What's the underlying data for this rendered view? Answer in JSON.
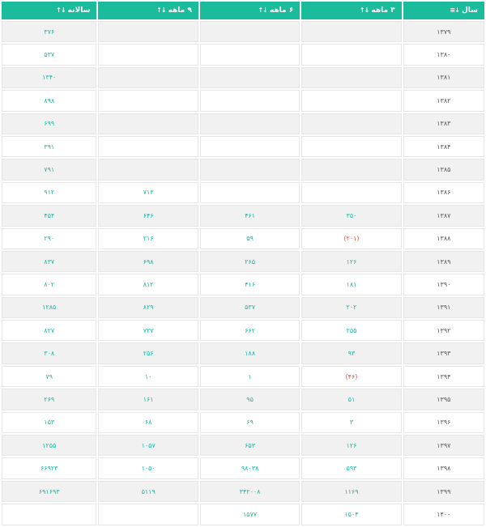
{
  "header": {
    "year": "سال",
    "m3": "۳ ماهه",
    "m6": "۶ ماهه",
    "m9": "۹ ماهه",
    "annual": "سالانه",
    "year_icon": "↓≡",
    "sort_icon": "↓↑"
  },
  "colors": {
    "header_bg": "#1abc9c",
    "value": "#14b8a6",
    "negative": "#e74c3c",
    "stripe": "#f1f1f1"
  },
  "rows": [
    {
      "year": "۱۳۷۹",
      "m3": "",
      "m6": "",
      "m9": "",
      "annual": "۳۷۶"
    },
    {
      "year": "۱۳۸۰",
      "m3": "",
      "m6": "",
      "m9": "",
      "annual": "۵۳۷"
    },
    {
      "year": "۱۳۸۱",
      "m3": "",
      "m6": "",
      "m9": "",
      "annual": "۱۳۴۰"
    },
    {
      "year": "۱۳۸۲",
      "m3": "",
      "m6": "",
      "m9": "",
      "annual": "۸۹۸"
    },
    {
      "year": "۱۳۸۳",
      "m3": "",
      "m6": "",
      "m9": "",
      "annual": "۶۹۹"
    },
    {
      "year": "۱۳۸۴",
      "m3": "",
      "m6": "",
      "m9": "",
      "annual": "۳۹۱"
    },
    {
      "year": "۱۳۸۵",
      "m3": "",
      "m6": "",
      "m9": "",
      "annual": "۷۹۱"
    },
    {
      "year": "۱۳۸۶",
      "m3": "",
      "m6": "",
      "m9": "۷۱۳",
      "annual": "۹۱۲"
    },
    {
      "year": "۱۳۸۷",
      "m3": "۳۵۰",
      "m6": "۴۶۱",
      "m9": "۶۴۶",
      "annual": "۴۵۴"
    },
    {
      "year": "۱۳۸۸",
      "m3": "(۲۰۱)",
      "m6": "۵۹",
      "m9": "۲۱۶",
      "annual": "۲۹۰"
    },
    {
      "year": "۱۳۸۹",
      "m3": "۱۲۶",
      "m6": "۲۶۵",
      "m9": "۶۹۸",
      "annual": "۸۳۷"
    },
    {
      "year": "۱۳۹۰",
      "m3": "۱۸۱",
      "m6": "۴۱۶",
      "m9": "۸۱۲",
      "annual": "۸۰۲"
    },
    {
      "year": "۱۳۹۱",
      "m3": "۲۰۲",
      "m6": "۵۳۷",
      "m9": "۸۲۹",
      "annual": "۱۲۸۵"
    },
    {
      "year": "۱۳۹۲",
      "m3": "۲۵۵",
      "m6": "۶۶۲",
      "m9": "۷۲۷",
      "annual": "۸۲۷"
    },
    {
      "year": "۱۳۹۳",
      "m3": "۹۳",
      "m6": "۱۸۸",
      "m9": "۲۵۶",
      "annual": "۳۰۸"
    },
    {
      "year": "۱۳۹۴",
      "m3": "(۴۶)",
      "m6": "۱",
      "m9": "۱۰",
      "annual": "۷۹"
    },
    {
      "year": "۱۳۹۵",
      "m3": "۵۱",
      "m6": "۹۵",
      "m9": "۱۶۱",
      "annual": "۲۶۹"
    },
    {
      "year": "۱۳۹۶",
      "m3": "۳",
      "m6": "۶۹",
      "m9": "۶۸",
      "annual": "۱۵۳"
    },
    {
      "year": "۱۳۹۷",
      "m3": "۱۲۶",
      "m6": "۶۵۳",
      "m9": "۱۰۵۷",
      "annual": "۱۲۵۵"
    },
    {
      "year": "۱۳۹۸",
      "m3": "۵۹۳",
      "m6": "۹۸۰۳۸",
      "m9": "۱۰۵۰",
      "annual": "۶۶۹۲۳"
    },
    {
      "year": "۱۳۹۹",
      "m3": "۱۱۶۹",
      "m6": "۳۴۲۰۰۸",
      "m9": "۵۱۱۹",
      "annual": "۶۹۱۶۹۳"
    },
    {
      "year": "۱۴۰۰",
      "m3": "۱۵۰۴",
      "m6": "۱۵۷۷",
      "m9": "",
      "annual": ""
    }
  ]
}
